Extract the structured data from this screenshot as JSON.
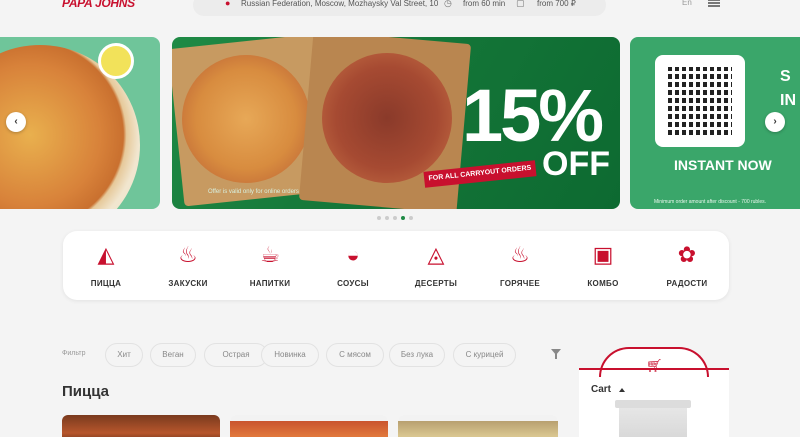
{
  "header": {
    "logo": "PAPA JOHNS",
    "address": "Russian Federation, Moscow, Mozhaysky Val Street, 10",
    "delivery_time": "from 60 min",
    "min_order": "from 700 ₽",
    "language": "En",
    "icons": {
      "address": "location-pin-icon",
      "time": "clock-icon",
      "order": "box-icon",
      "menu": "hamburger-menu-icon"
    }
  },
  "carousel": {
    "main_slide": {
      "discount": "15%",
      "off": "OFF",
      "ribbon": "FOR ALL CARRYOUT ORDERS",
      "note": "Offer is valid only for online orders"
    },
    "right_slide": {
      "title": "INSTANT NOW",
      "fineprint": "Minimum order amount after discount - 700 rubles.",
      "edge_text": "S IN"
    },
    "active_dot": 3,
    "dot_count": 5
  },
  "categories": [
    {
      "label": "ПИЦЦА",
      "icon": "pizza-slice-icon"
    },
    {
      "label": "ЗАКУСКИ",
      "icon": "snacks-icon"
    },
    {
      "label": "НАПИТКИ",
      "icon": "drink-cup-icon"
    },
    {
      "label": "СОУСЫ",
      "icon": "sauce-bowl-icon"
    },
    {
      "label": "ДЕСЕРТЫ",
      "icon": "cake-icon"
    },
    {
      "label": "ГОРЯЧЕЕ",
      "icon": "hot-pot-icon"
    },
    {
      "label": "КОМБО",
      "icon": "combo-box-icon"
    },
    {
      "label": "РАДОСТИ",
      "icon": "toy-bunny-icon"
    }
  ],
  "filters": {
    "label": "Фильтр",
    "chips": [
      "Хит",
      "Веган",
      "Острая",
      "Новинка",
      "С мясом",
      "Без лука",
      "С курицей"
    ]
  },
  "section": {
    "title": "Пицца"
  },
  "cart": {
    "label": "Cart"
  },
  "colors": {
    "brand_red": "#c8102e",
    "brand_green": "#1f8a45"
  }
}
